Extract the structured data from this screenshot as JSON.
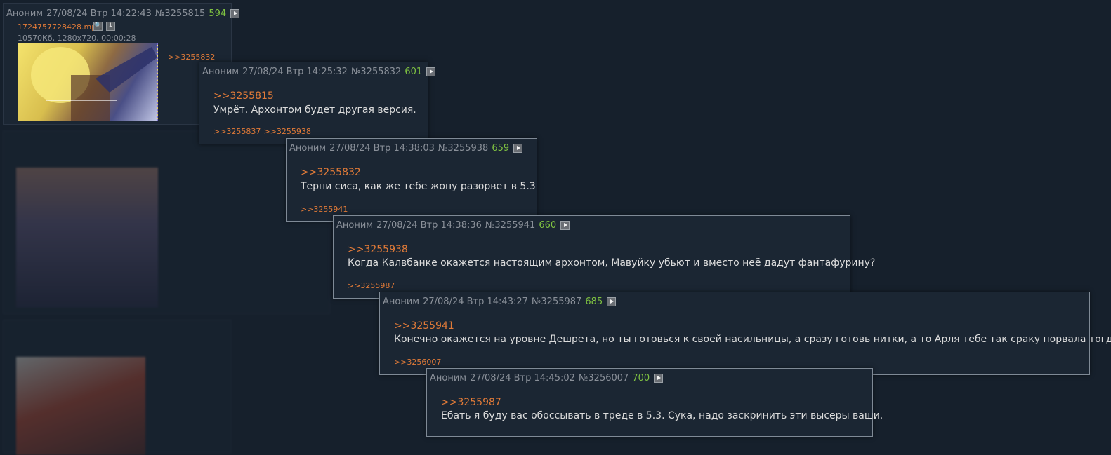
{
  "post_main": {
    "author": "Аноним",
    "date": "27/08/24 Втр 14:22:43",
    "num": "№3255815",
    "count": "594",
    "file_name": "1724757728428.mp4",
    "file_meta": "10570Кб, 1280x720, 00:00:28",
    "reply_link": ">>3255832",
    "thumb_colors": {
      "bg": "#c9b14f",
      "accent": "#f3e36a",
      "dark": "#2b2d55"
    }
  },
  "popups": [
    {
      "author": "Аноним",
      "date": "27/08/24 Втр 14:25:32",
      "num": "№3255832",
      "count": "601",
      "quote": ">>3255815",
      "text": "Умрёт. Архонтом будет другая версия.",
      "replies": [
        ">>3255837",
        ">>3255938"
      ]
    },
    {
      "author": "Аноним",
      "date": "27/08/24 Втр 14:38:03",
      "num": "№3255938",
      "count": "659",
      "quote": ">>3255832",
      "text": "Терпи сиса, как же тебе жопу разорвет в 5.3",
      "replies": [
        ">>3255941"
      ]
    },
    {
      "author": "Аноним",
      "date": "27/08/24 Втр 14:38:36",
      "num": "№3255941",
      "count": "660",
      "quote": ">>3255938",
      "text": "Когда Калвбанке окажется настоящим архонтом, Мавуйку убьют и вместо неё дадут фантафурину?",
      "replies": [
        ">>3255987"
      ]
    },
    {
      "author": "Аноним",
      "date": "27/08/24 Втр 14:43:27",
      "num": "№3255987",
      "count": "685",
      "quote": ">>3255941",
      "text": "Конечно окажется на уровне Дешрета, но ты готовься к своей насильницы, а сразу готовь нитки, а то Арля тебе так сраку порвала тогда.",
      "replies": [
        ">>3256007"
      ]
    },
    {
      "author": "Аноним",
      "date": "27/08/24 Втр 14:45:02",
      "num": "№3256007",
      "count": "700",
      "quote": ">>3255987",
      "text": "Ебать я буду вас обоссывать в треде в 5.3. Сука, надо заскринить эти высеры ваши.",
      "replies": []
    }
  ],
  "colors": {
    "background": "#16202c",
    "post_bg": "#1b2633",
    "link": "#e07a38",
    "count": "#7fc241",
    "meta": "#8a9099"
  }
}
